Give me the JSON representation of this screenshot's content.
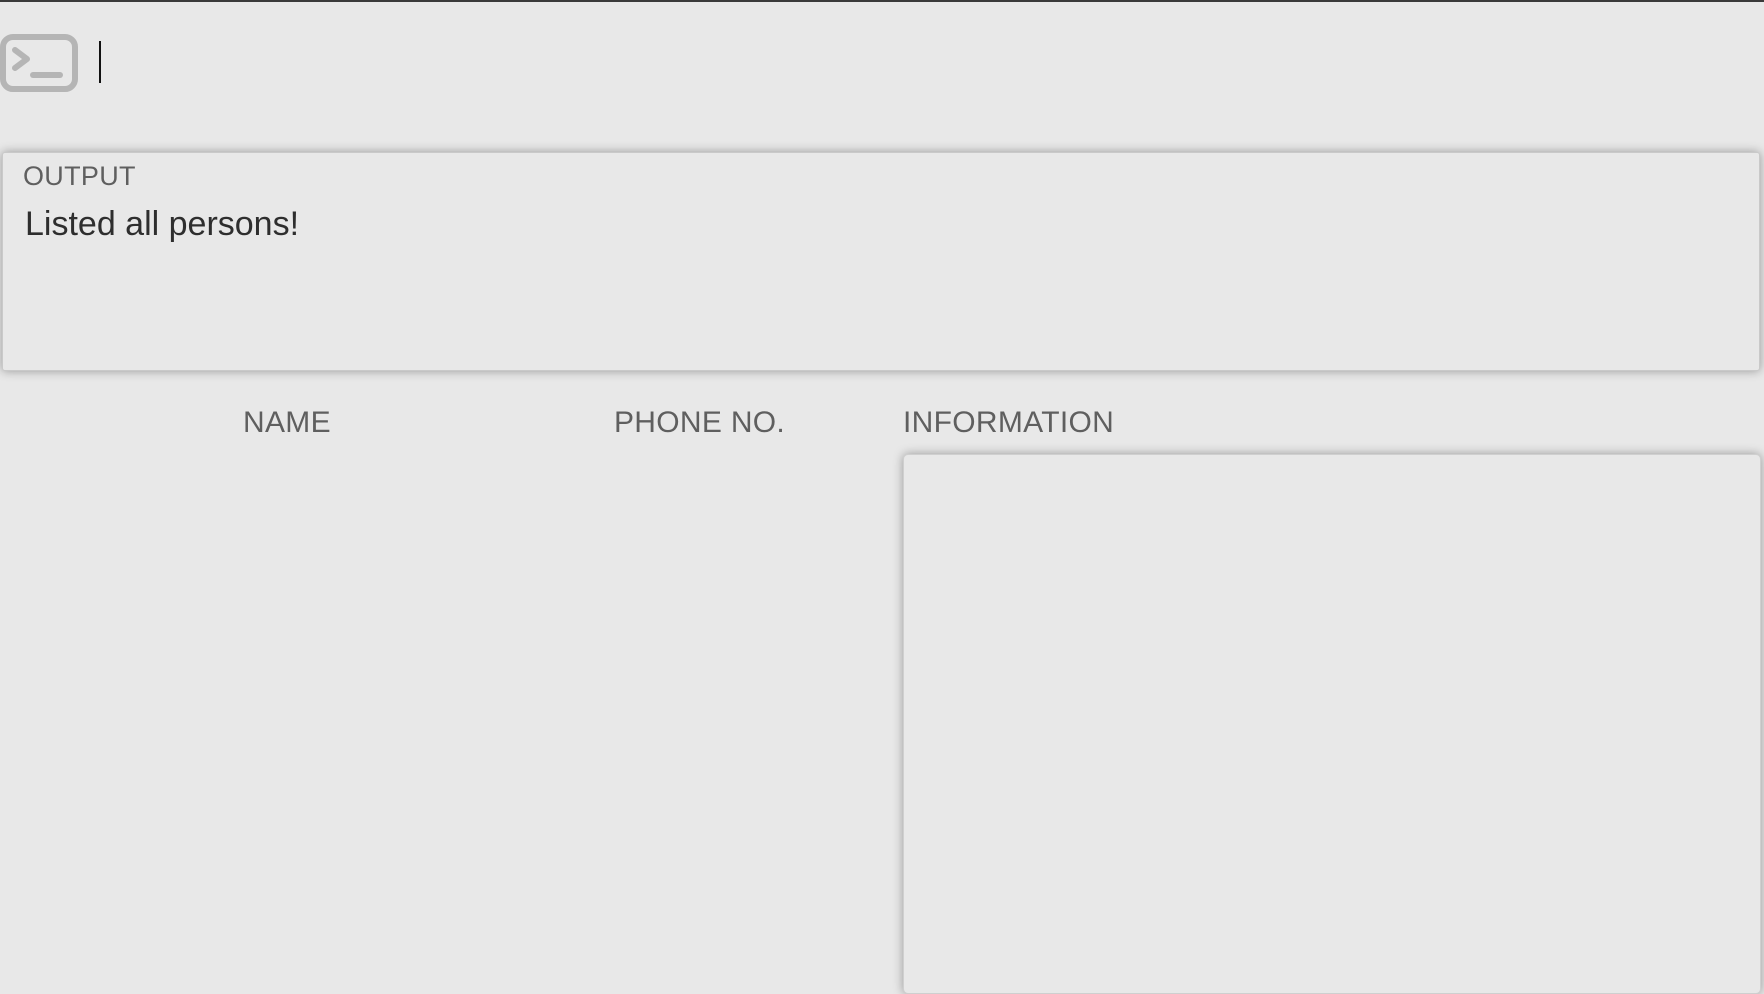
{
  "command_box": {
    "icon": "terminal-icon",
    "value": "",
    "placeholder": ""
  },
  "output": {
    "label": "OUTPUT",
    "message": "Listed all persons!"
  },
  "columns": {
    "name": "NAME",
    "phone": "PHONE NO.",
    "information": "INFORMATION"
  },
  "colors": {
    "background": "#e8e8e8",
    "header_text": "#5f5f5f",
    "body_text": "#2e2e2e",
    "icon": "#b5b5b5"
  }
}
